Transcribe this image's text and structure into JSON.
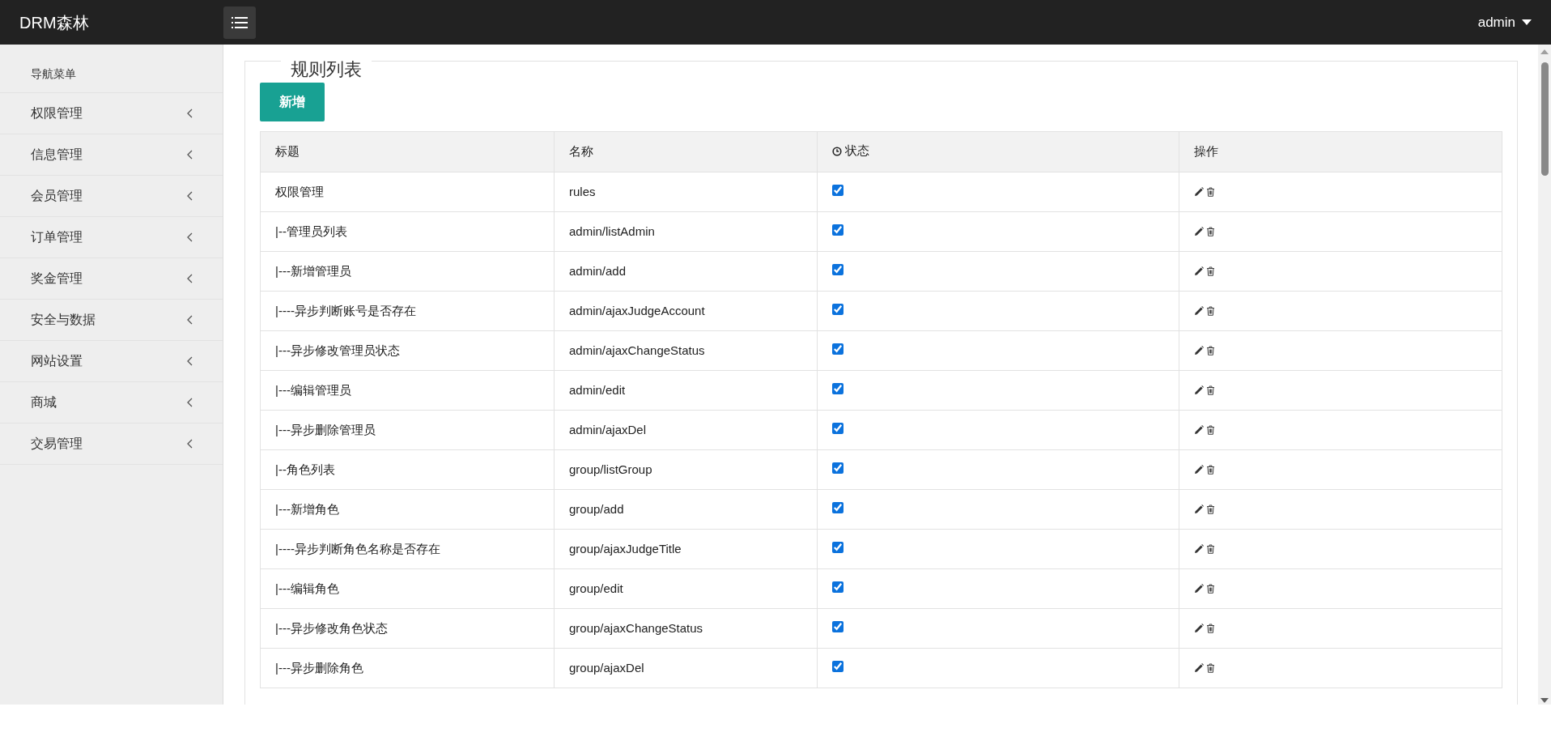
{
  "brand": "DRM森林",
  "user_menu": {
    "label": "admin"
  },
  "sidebar": {
    "heading": "导航菜单",
    "items": [
      {
        "label": "权限管理",
        "expanded": false
      },
      {
        "label": "信息管理",
        "expanded": false
      },
      {
        "label": "会员管理",
        "expanded": false
      },
      {
        "label": "订单管理",
        "expanded": false
      },
      {
        "label": "奖金管理",
        "expanded": false
      },
      {
        "label": "安全与数据",
        "expanded": false
      },
      {
        "label": "网站设置",
        "expanded": false
      },
      {
        "label": "商城",
        "expanded": false
      },
      {
        "label": "交易管理",
        "expanded": false
      }
    ]
  },
  "panel": {
    "title": "规则列表",
    "add_button": "新增"
  },
  "table": {
    "columns": [
      "标题",
      "名称",
      "状态",
      "操作"
    ],
    "rows": [
      {
        "title": "权限管理",
        "name": "rules",
        "checked": true
      },
      {
        "title": "|--管理员列表",
        "name": "admin/listAdmin",
        "checked": true
      },
      {
        "title": "|---新增管理员",
        "name": "admin/add",
        "checked": true
      },
      {
        "title": "|----异步判断账号是否存在",
        "name": "admin/ajaxJudgeAccount",
        "checked": true
      },
      {
        "title": "|---异步修改管理员状态",
        "name": "admin/ajaxChangeStatus",
        "checked": true
      },
      {
        "title": "|---编辑管理员",
        "name": "admin/edit",
        "checked": true
      },
      {
        "title": "|---异步删除管理员",
        "name": "admin/ajaxDel",
        "checked": true
      },
      {
        "title": "|--角色列表",
        "name": "group/listGroup",
        "checked": true
      },
      {
        "title": "|---新增角色",
        "name": "group/add",
        "checked": true
      },
      {
        "title": "|----异步判断角色名称是否存在",
        "name": "group/ajaxJudgeTitle",
        "checked": true
      },
      {
        "title": "|---编辑角色",
        "name": "group/edit",
        "checked": true
      },
      {
        "title": "|---异步修改角色状态",
        "name": "group/ajaxChangeStatus",
        "checked": true
      },
      {
        "title": "|---异步删除角色",
        "name": "group/ajaxDel",
        "checked": true
      }
    ]
  }
}
